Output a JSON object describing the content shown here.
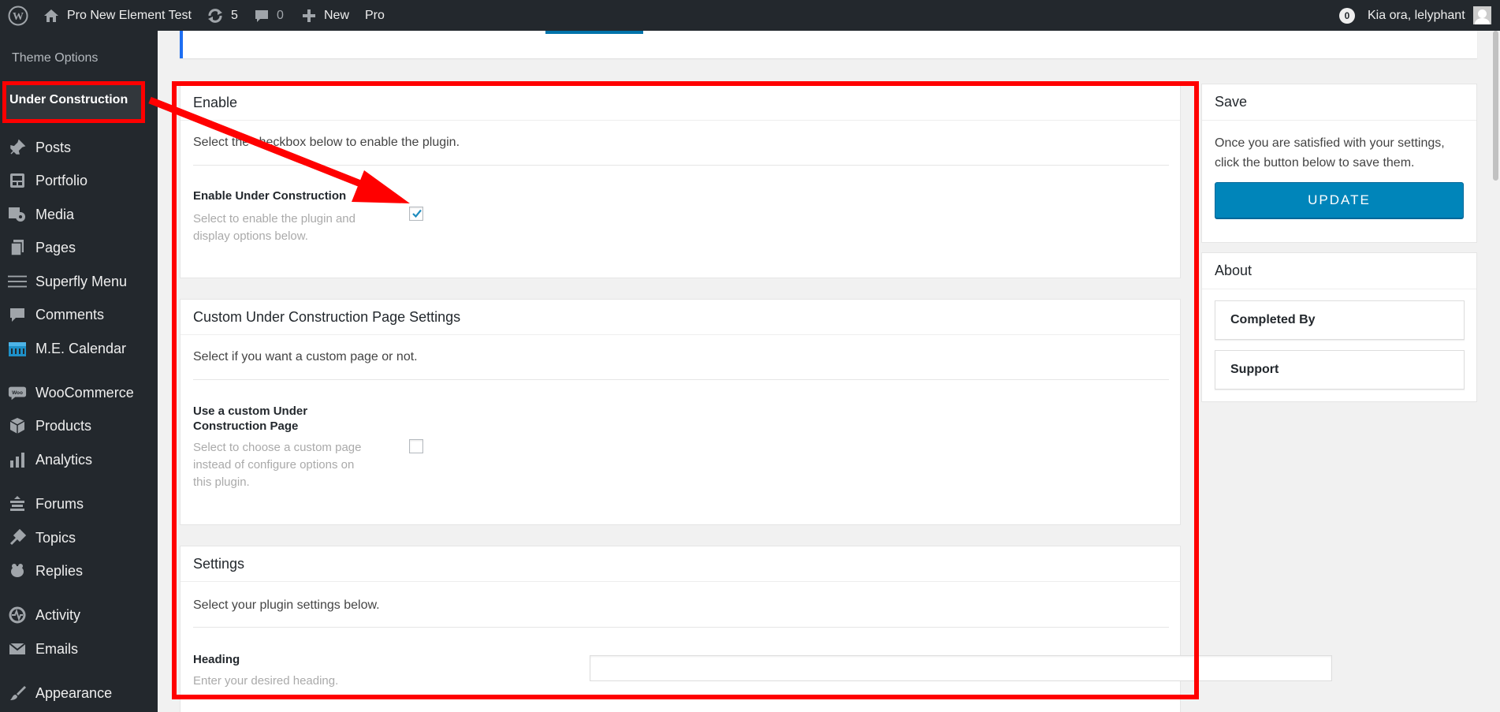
{
  "adminbar": {
    "site_name": "Pro New Element Test",
    "updates_count": "5",
    "comments_count": "0",
    "new_label": "New",
    "pro_label": "Pro",
    "notification_count": "0",
    "greeting": "Kia ora, lelyphant"
  },
  "sidebar": {
    "submenu_theme_options": "Theme Options",
    "submenu_under_construction": "Under Construction",
    "items": [
      {
        "label": "Posts",
        "icon": "pin-icon"
      },
      {
        "label": "Portfolio",
        "icon": "portfolio-icon"
      },
      {
        "label": "Media",
        "icon": "media-icon"
      },
      {
        "label": "Pages",
        "icon": "pages-icon"
      },
      {
        "label": "Superfly Menu",
        "icon": "menu-lines-icon"
      },
      {
        "label": "Comments",
        "icon": "comment-icon"
      },
      {
        "label": "M.E. Calendar",
        "icon": "calendar-icon"
      },
      {
        "label": "WooCommerce",
        "icon": "woo-icon"
      },
      {
        "label": "Products",
        "icon": "box-icon"
      },
      {
        "label": "Analytics",
        "icon": "bar-chart-icon"
      },
      {
        "label": "Forums",
        "icon": "forums-icon"
      },
      {
        "label": "Topics",
        "icon": "topics-icon"
      },
      {
        "label": "Replies",
        "icon": "replies-icon"
      },
      {
        "label": "Activity",
        "icon": "activity-icon"
      },
      {
        "label": "Emails",
        "icon": "mail-icon"
      },
      {
        "label": "Appearance",
        "icon": "brush-icon"
      }
    ]
  },
  "enable_panel": {
    "title": "Enable",
    "description": "Select the checkbox below to enable the plugin.",
    "field_label": "Enable Under Construction",
    "field_help": "Select to enable the plugin and display options below.",
    "checked": true
  },
  "custom_panel": {
    "title": "Custom Under Construction Page Settings",
    "description": "Select if you want a custom page or not.",
    "field_label": "Use a custom Under Construction Page",
    "field_help": "Select to choose a custom page instead of configure options on this plugin.",
    "checked": false
  },
  "settings_panel": {
    "title": "Settings",
    "description": "Select your plugin settings below.",
    "field_label": "Heading",
    "field_help": "Enter your desired heading.",
    "heading_value": ""
  },
  "save_box": {
    "title": "Save",
    "text": "Once you are satisfied with your settings, click the button below to save them.",
    "button_label": "UPDATE"
  },
  "about_box": {
    "title": "About",
    "completed_by_label": "Completed By",
    "support_label": "Support"
  },
  "colors": {
    "annotation": "#ff0000",
    "primary_button": "#0085ba",
    "admin_dark": "#23282d"
  }
}
